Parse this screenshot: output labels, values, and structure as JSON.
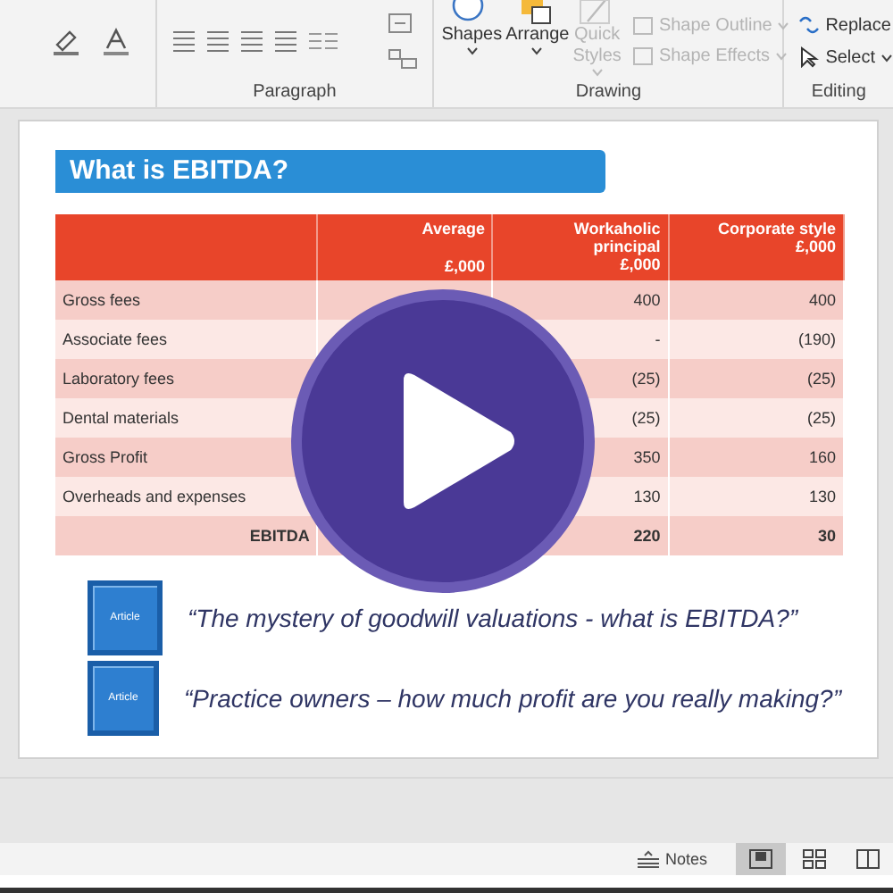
{
  "ribbon": {
    "group_labels": [
      "Paragraph",
      "Drawing",
      "Editing"
    ],
    "big_buttons": [
      {
        "label": "Shapes",
        "disabled": false
      },
      {
        "label": "Arrange",
        "disabled": false
      },
      {
        "label": "Quick Styles",
        "disabled": true
      }
    ],
    "small_buttons": [
      {
        "label": "Shape Outline",
        "disabled": true
      },
      {
        "label": "Shape Effects",
        "disabled": true
      }
    ],
    "editing": [
      {
        "label": "Replace",
        "kind": "replace"
      },
      {
        "label": "Select",
        "kind": "select"
      }
    ]
  },
  "slide": {
    "title": "What is EBITDA?",
    "columns": [
      {
        "lines": [
          "Average",
          "£,000"
        ]
      },
      {
        "lines": [
          "Workaholic",
          "principal",
          "£,000"
        ]
      },
      {
        "lines": [
          "Corporate style",
          "£,000"
        ]
      }
    ],
    "rows": [
      {
        "label": "Gross fees",
        "principal": "400",
        "corporate": "400",
        "total": false
      },
      {
        "label": "Associate fees",
        "principal": "-",
        "corporate": "(190)",
        "total": false
      },
      {
        "label": "Laboratory fees",
        "principal": "(25)",
        "corporate": "(25)",
        "total": false
      },
      {
        "label": "Dental materials",
        "principal": "(25)",
        "corporate": "(25)",
        "total": false
      },
      {
        "label": "Gross Profit",
        "principal": "350",
        "corporate": "160",
        "total": false
      },
      {
        "label": "Overheads and expenses",
        "principal": "130",
        "corporate": "130",
        "total": false
      },
      {
        "label": "EBITDA",
        "principal": "220",
        "corporate": "30",
        "total": true
      }
    ],
    "articles": [
      {
        "badge": "Article",
        "title": "“The mystery of goodwill valuations - what is EBITDA?”"
      },
      {
        "badge": "Article",
        "title": "“Practice owners – how much profit are you really making?”"
      }
    ]
  },
  "status_bar": {
    "notes": "Notes",
    "views": [
      {
        "selected": true
      },
      {
        "selected": false
      },
      {
        "selected": false
      }
    ]
  }
}
